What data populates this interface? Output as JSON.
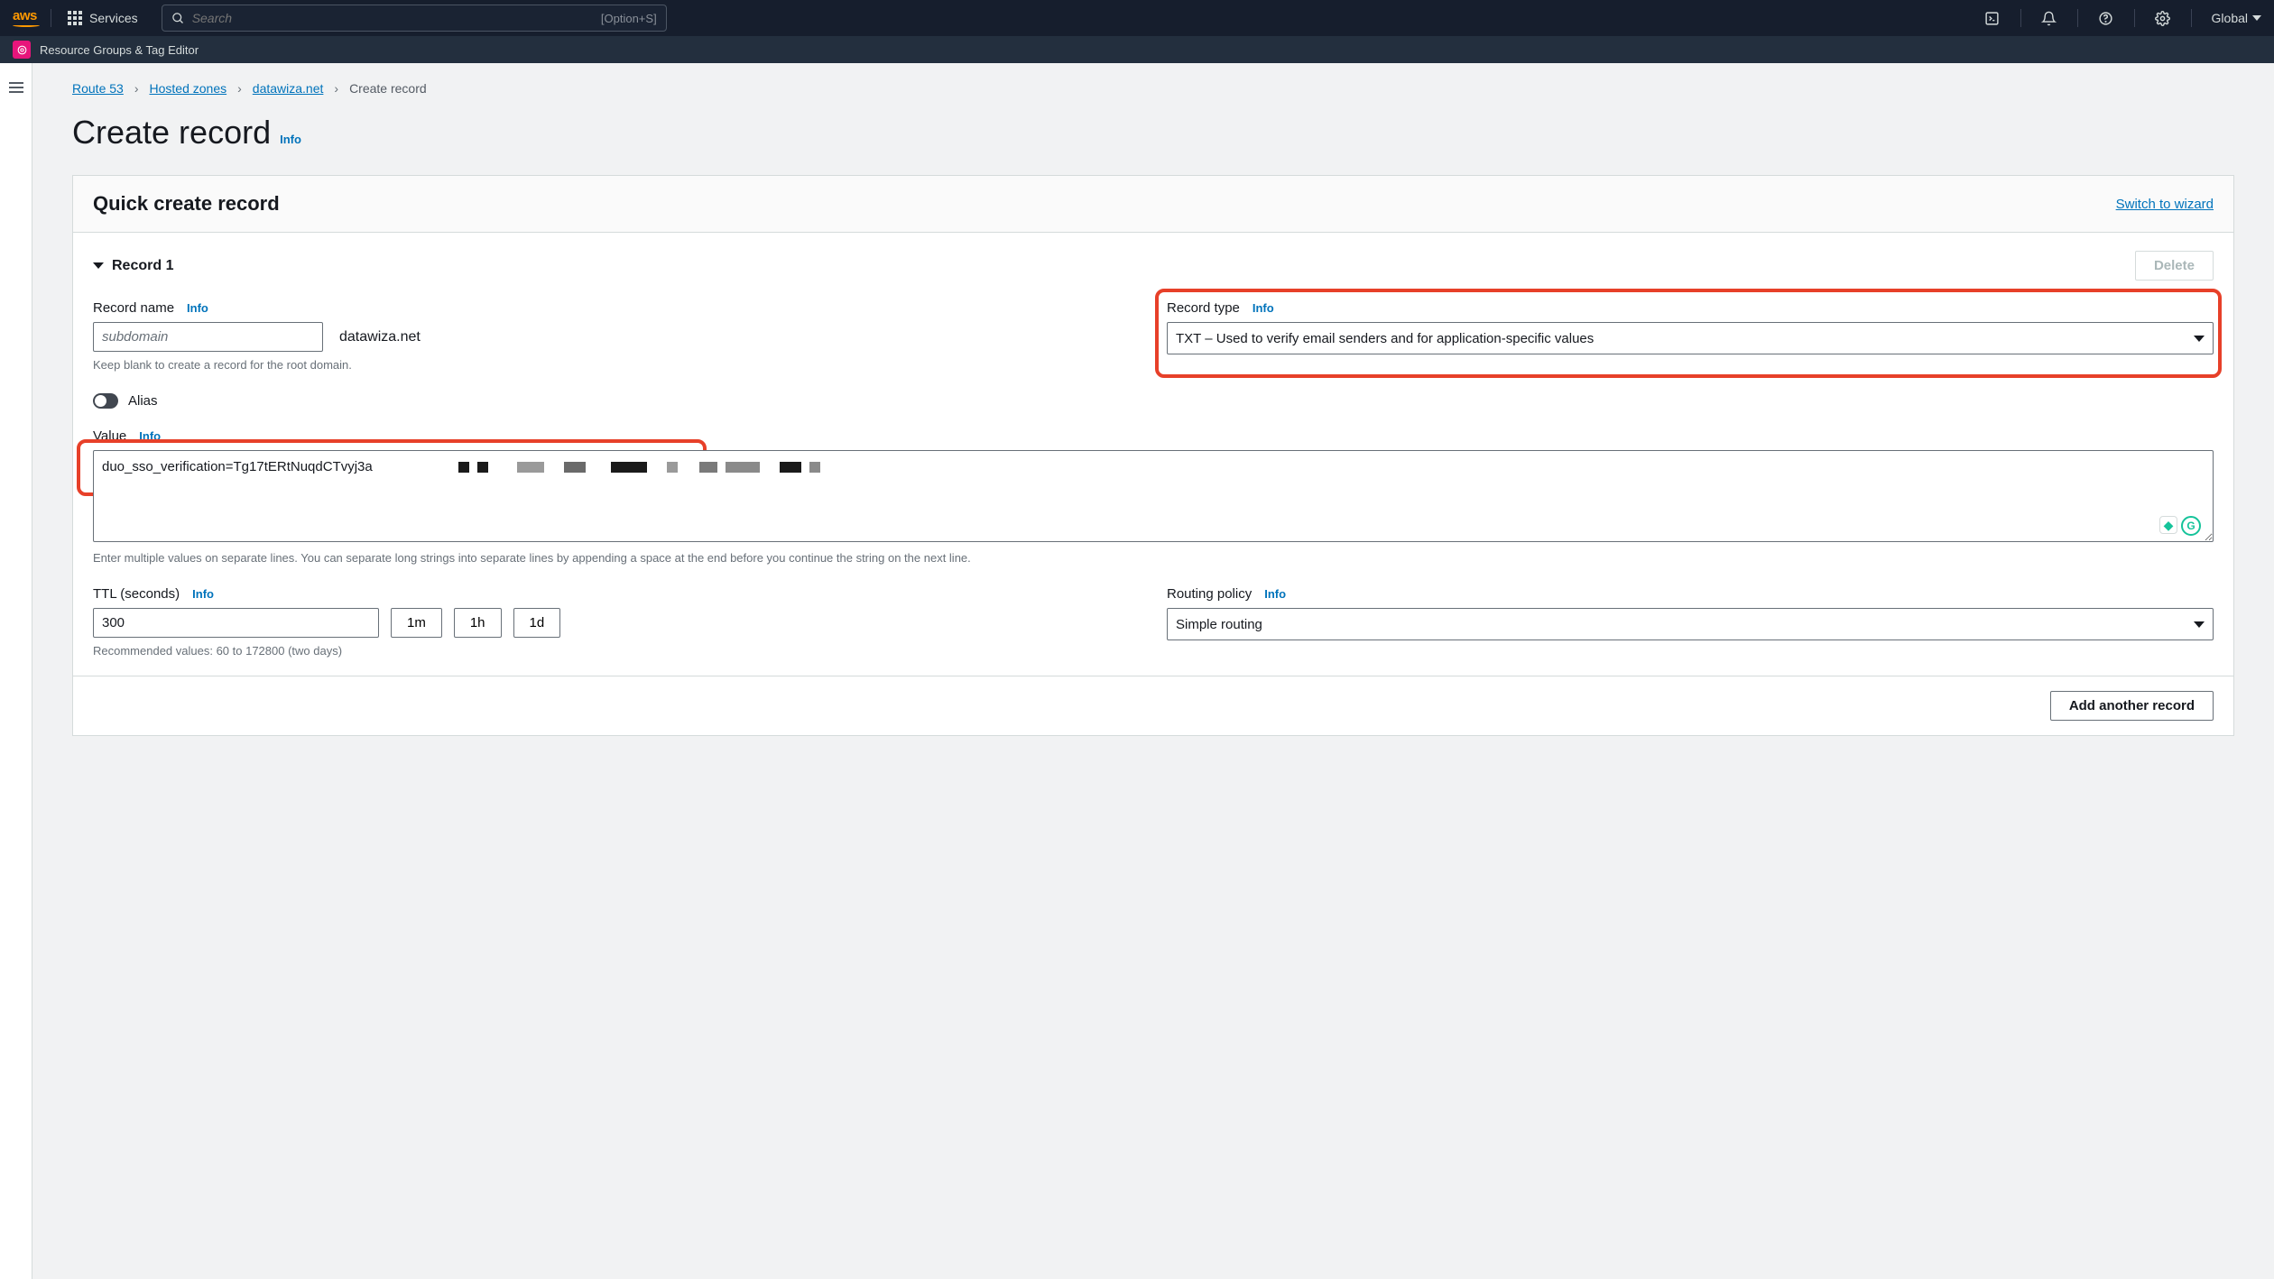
{
  "topnav": {
    "services_label": "Services",
    "search_placeholder": "Search",
    "search_shortcut": "[Option+S]",
    "region": "Global"
  },
  "subnav": {
    "resource_groups_label": "Resource Groups & Tag Editor"
  },
  "breadcrumb": {
    "items": [
      "Route 53",
      "Hosted zones",
      "datawiza.net"
    ],
    "current": "Create record"
  },
  "page": {
    "title": "Create record",
    "info": "Info"
  },
  "panel": {
    "header": "Quick create record",
    "switch_link": "Switch to wizard"
  },
  "record": {
    "title": "Record 1",
    "delete_label": "Delete",
    "name_label": "Record name",
    "name_placeholder": "subdomain",
    "name_value": "",
    "domain_suffix": "datawiza.net",
    "name_helper": "Keep blank to create a record for the root domain.",
    "type_label": "Record type",
    "type_value": "TXT – Used to verify email senders and for application-specific values",
    "alias_label": "Alias",
    "value_label": "Value",
    "value_text": "duo_sso_verification=Tg17tERtNuqdCTvyj3a",
    "value_helper": "Enter multiple values on separate lines. You can separate long strings into separate lines by appending a space at the end before you continue the string on the next line.",
    "ttl_label": "TTL (seconds)",
    "ttl_value": "300",
    "ttl_presets": {
      "m1": "1m",
      "h1": "1h",
      "d1": "1d"
    },
    "ttl_helper": "Recommended values: 60 to 172800 (two days)",
    "routing_label": "Routing policy",
    "routing_value": "Simple routing",
    "add_another_label": "Add another record",
    "info": "Info"
  }
}
